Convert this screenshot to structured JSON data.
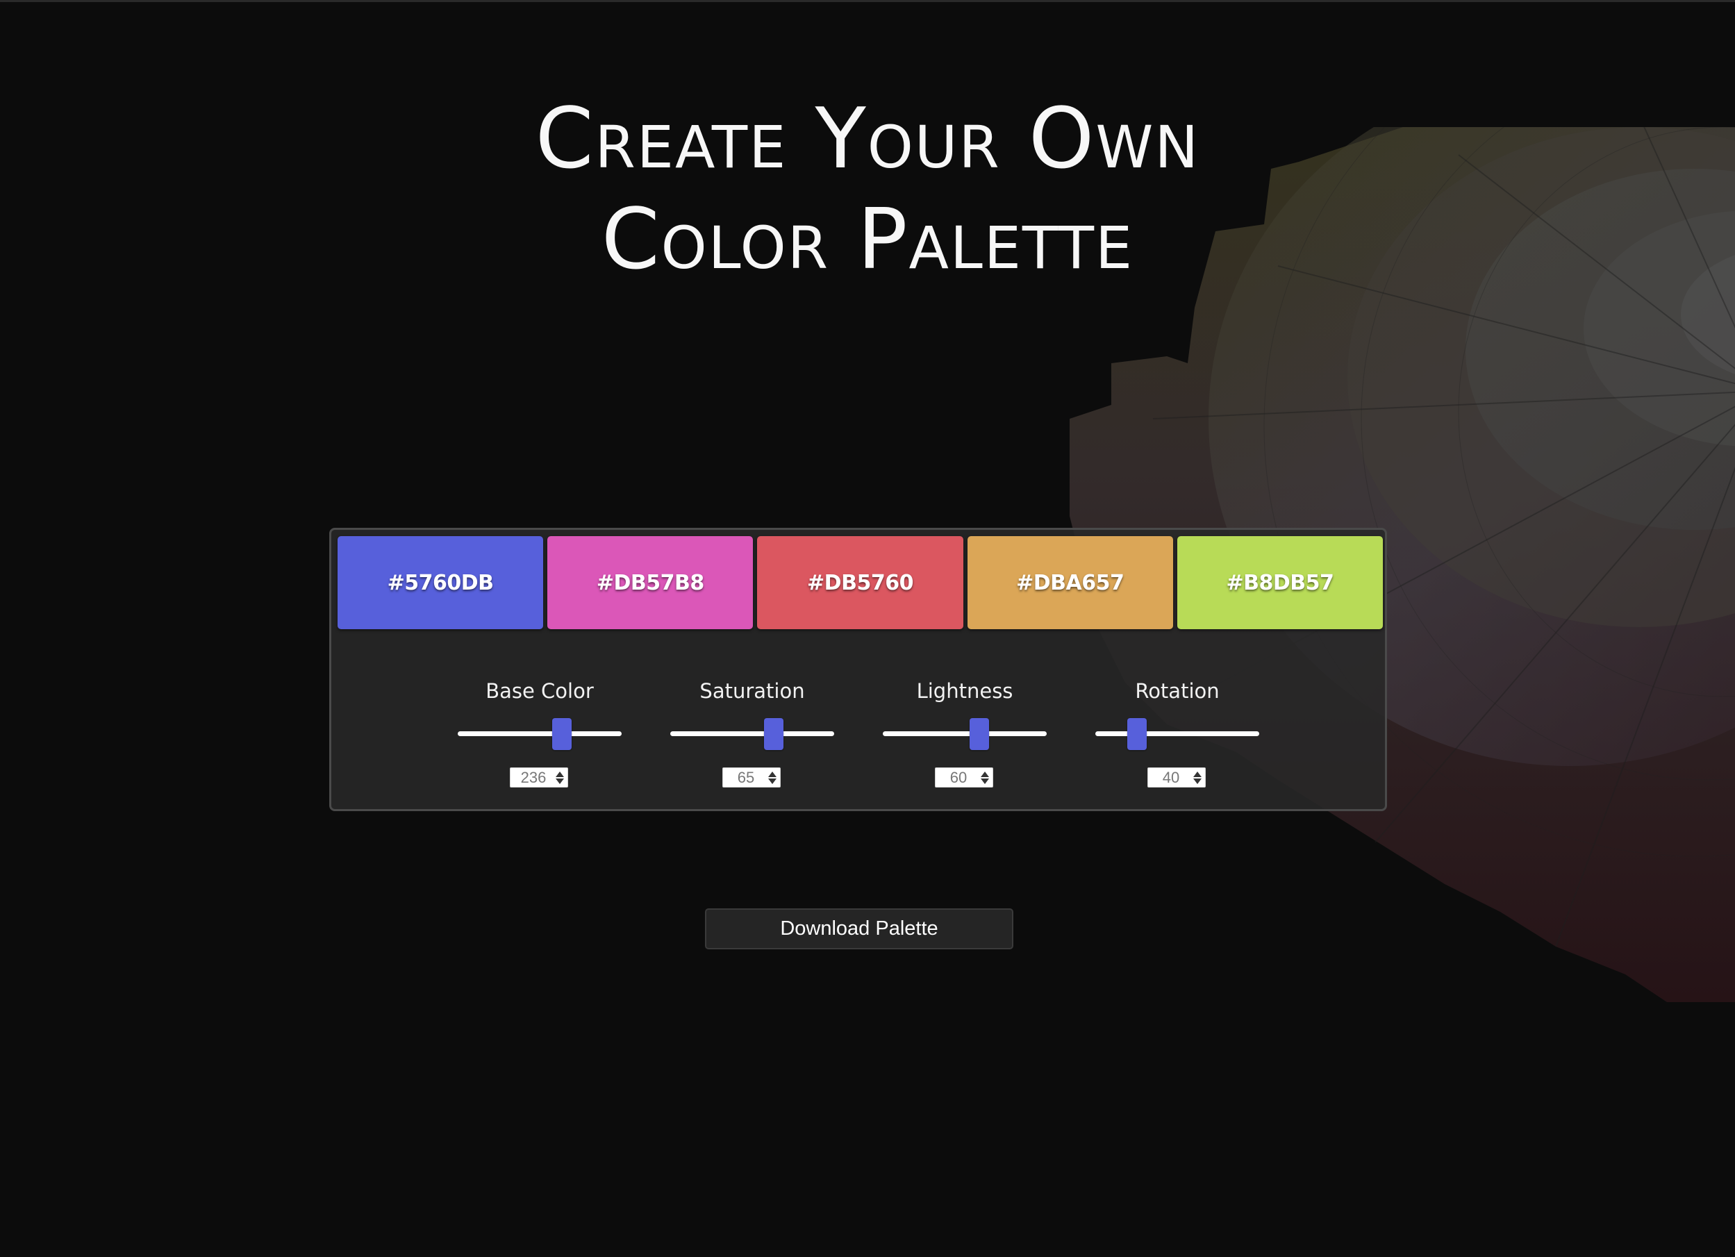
{
  "page": {
    "title_line1": "Create Your Own",
    "title_line2": "Color Palette"
  },
  "palette": {
    "swatches": [
      {
        "hex": "#5760DB",
        "color": "#5760DB"
      },
      {
        "hex": "#DB57B8",
        "color": "#DB57B8"
      },
      {
        "hex": "#DB5760",
        "color": "#DB5760"
      },
      {
        "hex": "#DBA657",
        "color": "#DBA657"
      },
      {
        "hex": "#B8DB57",
        "color": "#B8DB57"
      }
    ]
  },
  "controls": {
    "base_color": {
      "label": "Base Color",
      "value": "236",
      "min": 0,
      "max": 360
    },
    "saturation": {
      "label": "Saturation",
      "value": "65",
      "min": 0,
      "max": 100
    },
    "lightness": {
      "label": "Lightness",
      "value": "60",
      "min": 0,
      "max": 100
    },
    "rotation": {
      "label": "Rotation",
      "value": "40",
      "min": 0,
      "max": 180
    }
  },
  "actions": {
    "download_label": "Download Palette"
  },
  "theme": {
    "background": "#0c0c0c",
    "panel": "#282828",
    "accent": "#5760DB"
  }
}
